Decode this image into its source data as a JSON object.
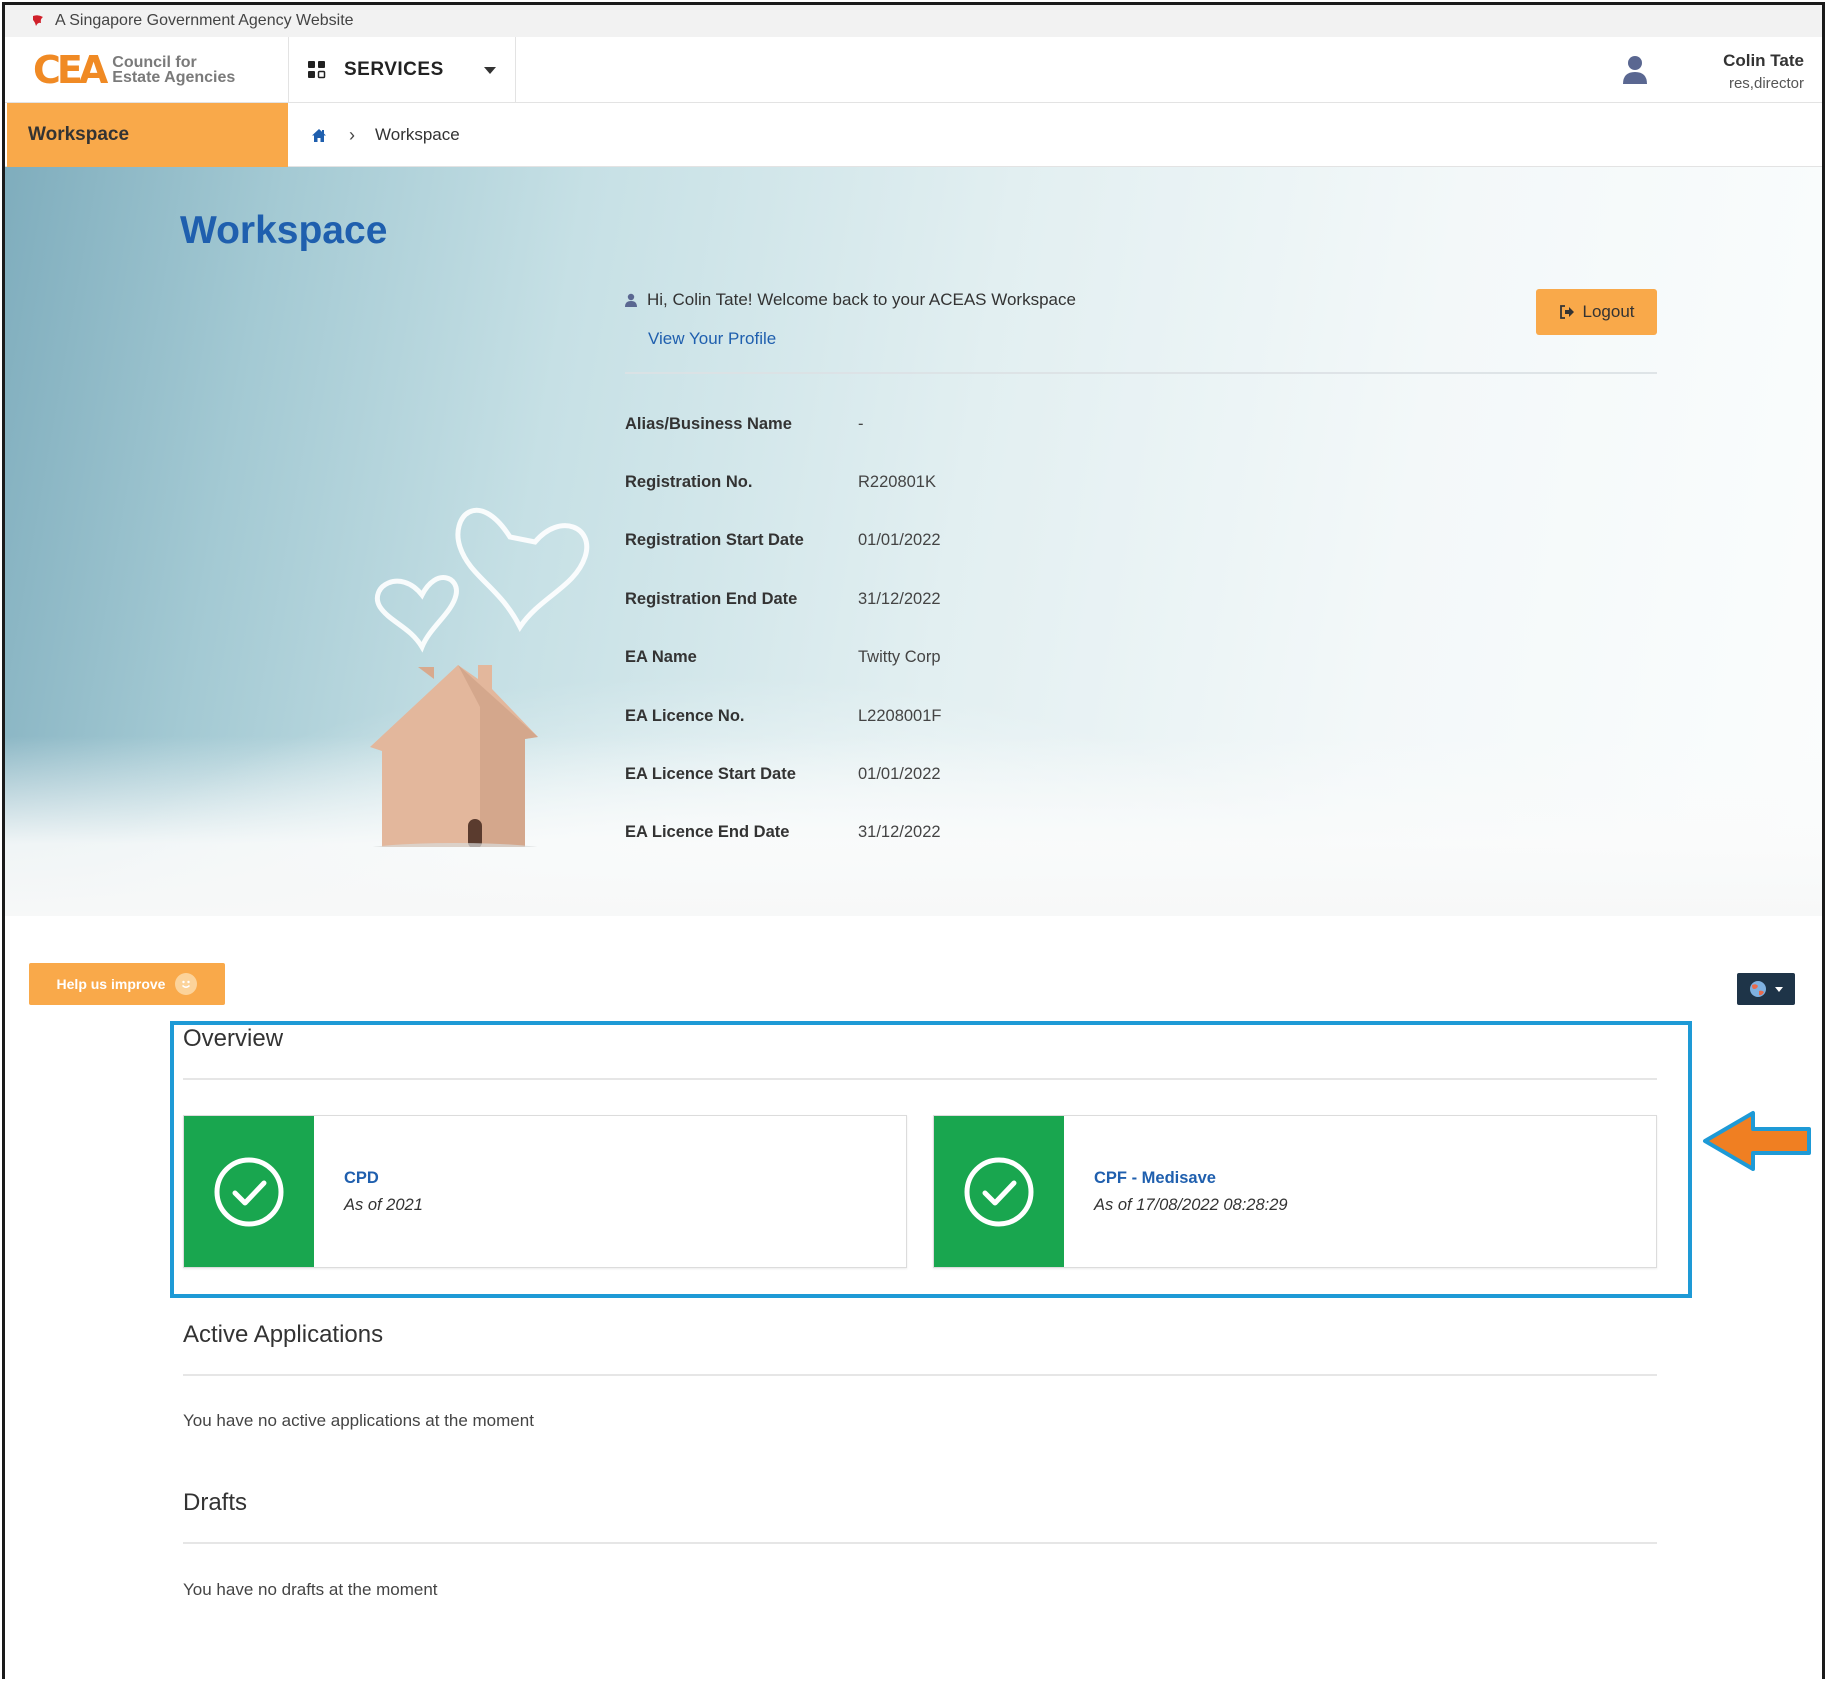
{
  "gov_bar": {
    "text": "A Singapore Government Agency Website"
  },
  "header": {
    "logo_mark": "CEA",
    "logo_line1": "Council for",
    "logo_line2": "Estate Agencies",
    "services_label": "SERVICES",
    "user_name": "Colin Tate",
    "user_role": "res,director"
  },
  "nav": {
    "active_tab": "Workspace",
    "breadcrumb_current": "Workspace"
  },
  "hero": {
    "title": "Workspace",
    "welcome": "Hi, Colin Tate! Welcome back to your ACEAS Workspace",
    "profile_link": "View Your Profile",
    "logout_label": "Logout",
    "fields": [
      {
        "label": "Alias/Business Name",
        "value": "-"
      },
      {
        "label": "Registration No.",
        "value": "R220801K"
      },
      {
        "label": "Registration Start Date",
        "value": "01/01/2022"
      },
      {
        "label": "Registration End Date",
        "value": "31/12/2022"
      },
      {
        "label": "EA Name",
        "value": "Twitty Corp"
      },
      {
        "label": "EA Licence No.",
        "value": "L2208001F"
      },
      {
        "label": "EA Licence Start Date",
        "value": "01/01/2022"
      },
      {
        "label": "EA Licence End Date",
        "value": "31/12/2022"
      }
    ]
  },
  "help_button": "Help us improve",
  "overview": {
    "title": "Overview",
    "cards": [
      {
        "title": "CPD",
        "subtitle": "As of 2021"
      },
      {
        "title": "CPF - Medisave",
        "subtitle": "As of 17/08/2022 08:28:29"
      }
    ]
  },
  "active_applications": {
    "title": "Active Applications",
    "empty_text": "You have no active applications at the moment"
  },
  "drafts": {
    "title": "Drafts",
    "empty_text": "You have no drafts at the moment"
  },
  "colors": {
    "accent_orange": "#f9a94a",
    "brand_blue": "#1f5fae",
    "success_green": "#19a64f",
    "highlight_blue": "#1e9ad6",
    "annotation_arrow": "#f07f22"
  }
}
